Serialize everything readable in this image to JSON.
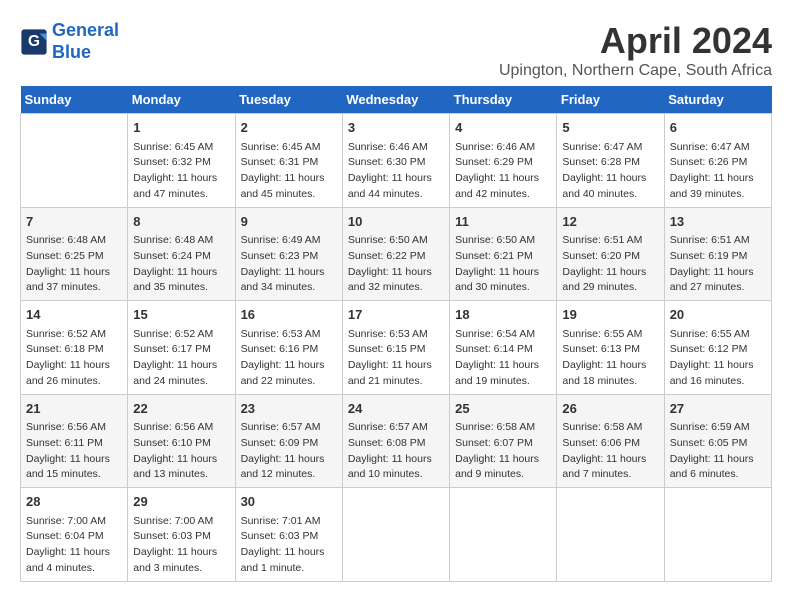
{
  "header": {
    "logo_line1": "General",
    "logo_line2": "Blue",
    "month_year": "April 2024",
    "location": "Upington, Northern Cape, South Africa"
  },
  "days_of_week": [
    "Sunday",
    "Monday",
    "Tuesday",
    "Wednesday",
    "Thursday",
    "Friday",
    "Saturday"
  ],
  "weeks": [
    [
      {
        "day": "",
        "info": ""
      },
      {
        "day": "1",
        "info": "Sunrise: 6:45 AM\nSunset: 6:32 PM\nDaylight: 11 hours\nand 47 minutes."
      },
      {
        "day": "2",
        "info": "Sunrise: 6:45 AM\nSunset: 6:31 PM\nDaylight: 11 hours\nand 45 minutes."
      },
      {
        "day": "3",
        "info": "Sunrise: 6:46 AM\nSunset: 6:30 PM\nDaylight: 11 hours\nand 44 minutes."
      },
      {
        "day": "4",
        "info": "Sunrise: 6:46 AM\nSunset: 6:29 PM\nDaylight: 11 hours\nand 42 minutes."
      },
      {
        "day": "5",
        "info": "Sunrise: 6:47 AM\nSunset: 6:28 PM\nDaylight: 11 hours\nand 40 minutes."
      },
      {
        "day": "6",
        "info": "Sunrise: 6:47 AM\nSunset: 6:26 PM\nDaylight: 11 hours\nand 39 minutes."
      }
    ],
    [
      {
        "day": "7",
        "info": "Sunrise: 6:48 AM\nSunset: 6:25 PM\nDaylight: 11 hours\nand 37 minutes."
      },
      {
        "day": "8",
        "info": "Sunrise: 6:48 AM\nSunset: 6:24 PM\nDaylight: 11 hours\nand 35 minutes."
      },
      {
        "day": "9",
        "info": "Sunrise: 6:49 AM\nSunset: 6:23 PM\nDaylight: 11 hours\nand 34 minutes."
      },
      {
        "day": "10",
        "info": "Sunrise: 6:50 AM\nSunset: 6:22 PM\nDaylight: 11 hours\nand 32 minutes."
      },
      {
        "day": "11",
        "info": "Sunrise: 6:50 AM\nSunset: 6:21 PM\nDaylight: 11 hours\nand 30 minutes."
      },
      {
        "day": "12",
        "info": "Sunrise: 6:51 AM\nSunset: 6:20 PM\nDaylight: 11 hours\nand 29 minutes."
      },
      {
        "day": "13",
        "info": "Sunrise: 6:51 AM\nSunset: 6:19 PM\nDaylight: 11 hours\nand 27 minutes."
      }
    ],
    [
      {
        "day": "14",
        "info": "Sunrise: 6:52 AM\nSunset: 6:18 PM\nDaylight: 11 hours\nand 26 minutes."
      },
      {
        "day": "15",
        "info": "Sunrise: 6:52 AM\nSunset: 6:17 PM\nDaylight: 11 hours\nand 24 minutes."
      },
      {
        "day": "16",
        "info": "Sunrise: 6:53 AM\nSunset: 6:16 PM\nDaylight: 11 hours\nand 22 minutes."
      },
      {
        "day": "17",
        "info": "Sunrise: 6:53 AM\nSunset: 6:15 PM\nDaylight: 11 hours\nand 21 minutes."
      },
      {
        "day": "18",
        "info": "Sunrise: 6:54 AM\nSunset: 6:14 PM\nDaylight: 11 hours\nand 19 minutes."
      },
      {
        "day": "19",
        "info": "Sunrise: 6:55 AM\nSunset: 6:13 PM\nDaylight: 11 hours\nand 18 minutes."
      },
      {
        "day": "20",
        "info": "Sunrise: 6:55 AM\nSunset: 6:12 PM\nDaylight: 11 hours\nand 16 minutes."
      }
    ],
    [
      {
        "day": "21",
        "info": "Sunrise: 6:56 AM\nSunset: 6:11 PM\nDaylight: 11 hours\nand 15 minutes."
      },
      {
        "day": "22",
        "info": "Sunrise: 6:56 AM\nSunset: 6:10 PM\nDaylight: 11 hours\nand 13 minutes."
      },
      {
        "day": "23",
        "info": "Sunrise: 6:57 AM\nSunset: 6:09 PM\nDaylight: 11 hours\nand 12 minutes."
      },
      {
        "day": "24",
        "info": "Sunrise: 6:57 AM\nSunset: 6:08 PM\nDaylight: 11 hours\nand 10 minutes."
      },
      {
        "day": "25",
        "info": "Sunrise: 6:58 AM\nSunset: 6:07 PM\nDaylight: 11 hours\nand 9 minutes."
      },
      {
        "day": "26",
        "info": "Sunrise: 6:58 AM\nSunset: 6:06 PM\nDaylight: 11 hours\nand 7 minutes."
      },
      {
        "day": "27",
        "info": "Sunrise: 6:59 AM\nSunset: 6:05 PM\nDaylight: 11 hours\nand 6 minutes."
      }
    ],
    [
      {
        "day": "28",
        "info": "Sunrise: 7:00 AM\nSunset: 6:04 PM\nDaylight: 11 hours\nand 4 minutes."
      },
      {
        "day": "29",
        "info": "Sunrise: 7:00 AM\nSunset: 6:03 PM\nDaylight: 11 hours\nand 3 minutes."
      },
      {
        "day": "30",
        "info": "Sunrise: 7:01 AM\nSunset: 6:03 PM\nDaylight: 11 hours\nand 1 minute."
      },
      {
        "day": "",
        "info": ""
      },
      {
        "day": "",
        "info": ""
      },
      {
        "day": "",
        "info": ""
      },
      {
        "day": "",
        "info": ""
      }
    ]
  ]
}
